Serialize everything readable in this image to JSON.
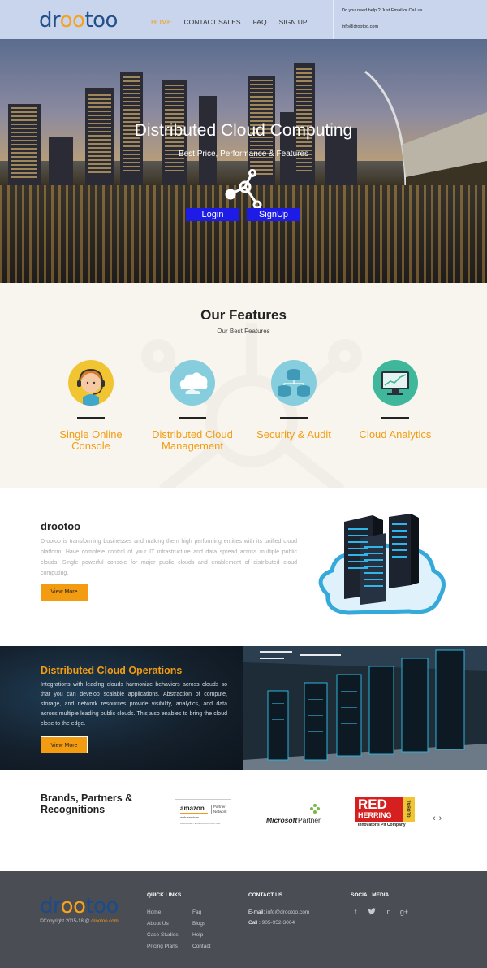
{
  "header": {
    "logo_part1": "dr",
    "logo_part2": "oo",
    "logo_part3": "too",
    "nav": [
      "HOME",
      "CONTACT SALES",
      "FAQ",
      "SIGN UP"
    ],
    "help_text": "Do you need help ? Just Email or Call us",
    "email": "info@drootoo.com"
  },
  "hero": {
    "title": "Distributed Cloud Computing",
    "subtitle": "Best Price, Performance & Features",
    "login_label": "Login",
    "signup_label": "SignUp"
  },
  "features": {
    "title": "Our Features",
    "subtitle": "Our Best Features",
    "items": [
      {
        "line1": "Single Online",
        "line2": "Console",
        "icon": "support-agent-icon",
        "color": "#f1c432"
      },
      {
        "line1": "Distributed Cloud",
        "line2": "Management",
        "icon": "cloud-icon",
        "color": "#86cddd"
      },
      {
        "line1": "Security & Audit",
        "line2": "",
        "icon": "database-icon",
        "color": "#86cddd"
      },
      {
        "line1": "Cloud Analytics",
        "line2": "",
        "icon": "analytics-monitor-icon",
        "color": "#3fb79a"
      }
    ]
  },
  "about": {
    "title": "drootoo",
    "text": "Drootoo is transforming businesses and making them high performing entities with its unified cloud platform. Have complete control of your IT infrastructure and data spread across multiple public clouds. Single powerful console for major public clouds and enablement of distributed cloud computing.",
    "button_label": "View More"
  },
  "operations": {
    "title": "Distributed Cloud Operations",
    "text": "Integrations with leading clouds harmonize behaviors across clouds so that you can develop scalable applications. Abstraction of compute, storage, and network resources provide visibility, analytics, and data across multiple leading public clouds. This also enables to bring the cloud close to the edge.",
    "button_label": "View More"
  },
  "brands": {
    "title": "Brands, Partners & Recognitions",
    "amazon_line1": "amazon",
    "amazon_line2": "web services",
    "amazon_partner": "Partner Network",
    "amazon_tier": "ADVANCED TECHNOLOGY PARTNER",
    "microsoft": "Microsoft",
    "microsoft_partner": "Partner",
    "red_word": "RED",
    "herring_word": "HERRING",
    "global_word": "GLOBAL",
    "red_tagline": "Innovator's Pit Company"
  },
  "footer": {
    "logo_part1": "dr",
    "logo_part2": "oo",
    "logo_part3": "too",
    "copyright_prefix": "©Copyright 2015-18 @",
    "copyright_site": "drootoo.com",
    "quick_links_title": "QUICK LINKS",
    "quick_links_col1": [
      "Home",
      "About Us",
      "Case Studies",
      "Pricing Plans"
    ],
    "quick_links_col2": [
      "Faq",
      "Blogs",
      "Help",
      "Contact"
    ],
    "contact_title": "CONTACT US",
    "email_label": "E-mail:",
    "email_value": "info@drootoo.com",
    "call_label": "Call :",
    "call_value": "905-952-3064",
    "social_title": "SOCIAL MEDIA",
    "social_icons": [
      "f",
      "t",
      "in",
      "g+"
    ]
  }
}
